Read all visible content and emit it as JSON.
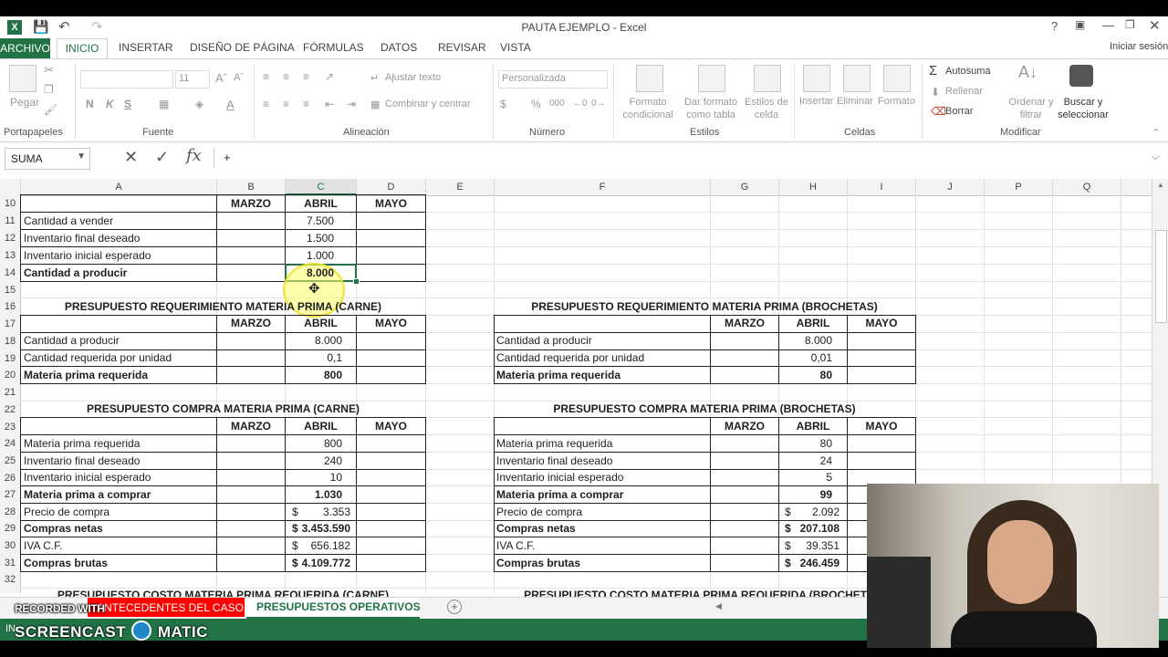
{
  "title": "PAUTA EJEMPLO - Excel",
  "ribbon": {
    "tabs": [
      "ARCHIVO",
      "INICIO",
      "INSERTAR",
      "DISEÑO DE PÁGINA",
      "FÓRMULAS",
      "DATOS",
      "REVISAR",
      "VISTA"
    ],
    "signin": "Iniciar sesión",
    "paste": "Pegar",
    "clipboard": "Portapapeles",
    "font_group": "Fuente",
    "font_size": "11",
    "alignment_group": "Alineación",
    "wrap_text": "Ajustar texto",
    "merge": "Combinar y centrar",
    "number_format": "Personalizada",
    "number_group": "Número",
    "cond_format": "Formato condicional",
    "format_table": "Dar formato como tabla",
    "cell_styles": "Estilos de celda",
    "styles_group": "Estilos",
    "insert": "Insertar",
    "delete": "Eliminar",
    "format": "Formato",
    "cells_group": "Celdas",
    "autosum": "Autosuma",
    "fill": "Rellenar",
    "clear": "Borrar",
    "sort_filter": "Ordenar y filtrar",
    "find_select": "Buscar y seleccionar",
    "editing_group": "Modificar"
  },
  "formula": {
    "name_box": "SUMA",
    "content": "+"
  },
  "columns": [
    "A",
    "B",
    "C",
    "D",
    "E",
    "F",
    "G",
    "H",
    "I",
    "J",
    "P",
    "Q"
  ],
  "rows": [
    "10",
    "11",
    "12",
    "13",
    "14",
    "15",
    "16",
    "17",
    "18",
    "19",
    "20",
    "21",
    "22",
    "23",
    "24",
    "25",
    "26",
    "27",
    "28",
    "29",
    "30",
    "31",
    "32"
  ],
  "headers": {
    "marzo": "MARZO",
    "abril": "ABRIL",
    "mayo": "MAYO"
  },
  "top_table": {
    "labels": [
      "Cantidad a vender",
      "Inventario final deseado",
      "Inventario inicial esperado",
      "Cantidad a producir"
    ],
    "abril": [
      "7.500",
      "1.500",
      "1.000",
      "8.000"
    ]
  },
  "req_carne": {
    "title": "PRESUPUESTO REQUERIMIENTO MATERIA PRIMA (CARNE)",
    "labels": [
      "Cantidad a producir",
      "Cantidad requerida por unidad",
      "Materia prima requerida"
    ],
    "abril": [
      "8.000",
      "0,1",
      "800"
    ]
  },
  "req_brochetas": {
    "title": "PRESUPUESTO REQUERIMIENTO MATERIA PRIMA (BROCHETAS)",
    "labels": [
      "Cantidad a producir",
      "Cantidad requerida por unidad",
      "Materia prima requerida"
    ],
    "abril": [
      "8.000",
      "0,01",
      "80"
    ]
  },
  "compra_carne": {
    "title": "PRESUPUESTO COMPRA MATERIA PRIMA (CARNE)",
    "labels": [
      "Materia prima requerida",
      "Inventario final deseado",
      "Inventario inicial esperado",
      "Materia prima a comprar",
      "Precio de compra",
      "Compras netas",
      "IVA C.F.",
      "Compras brutas"
    ],
    "currency": [
      "",
      "",
      "",
      "",
      "$",
      "$",
      "$",
      "$"
    ],
    "abril": [
      "800",
      "240",
      "10",
      "1.030",
      "3.353",
      "3.453.590",
      "656.182",
      "4.109.772"
    ]
  },
  "compra_brochetas": {
    "title": "PRESUPUESTO COMPRA MATERIA PRIMA (BROCHETAS)",
    "labels": [
      "Materia prima requerida",
      "Inventario final deseado",
      "Inventario inicial esperado",
      "Materia prima a comprar",
      "Precio de compra",
      "Compras netas",
      "IVA C.F.",
      "Compras brutas"
    ],
    "currency": [
      "",
      "",
      "",
      "",
      "$",
      "$",
      "$",
      "$"
    ],
    "abril": [
      "80",
      "24",
      "5",
      "99",
      "2.092",
      "207.108",
      "39.351",
      "246.459"
    ]
  },
  "partial_row": {
    "left": "PRESUPUESTO COSTO MATERIA PRIMA REQUERIDA (CARNE)",
    "right": "PRESUPUESTO COSTO MATERIA PRIMA REQUERIDA (BROCHETAS)"
  },
  "sheets": [
    "ANTECEDENTES DEL CASO",
    "PRESUPUESTOS OPERATIVOS"
  ],
  "watermark": {
    "recorded": "RECORDED WITH",
    "brand_a": "SCREENCAST",
    "brand_b": "MATIC"
  },
  "status_text": "IN",
  "colors": {
    "excel_green": "#217346",
    "sheet_red": "#ff0000",
    "highlight": "#ffff66"
  }
}
